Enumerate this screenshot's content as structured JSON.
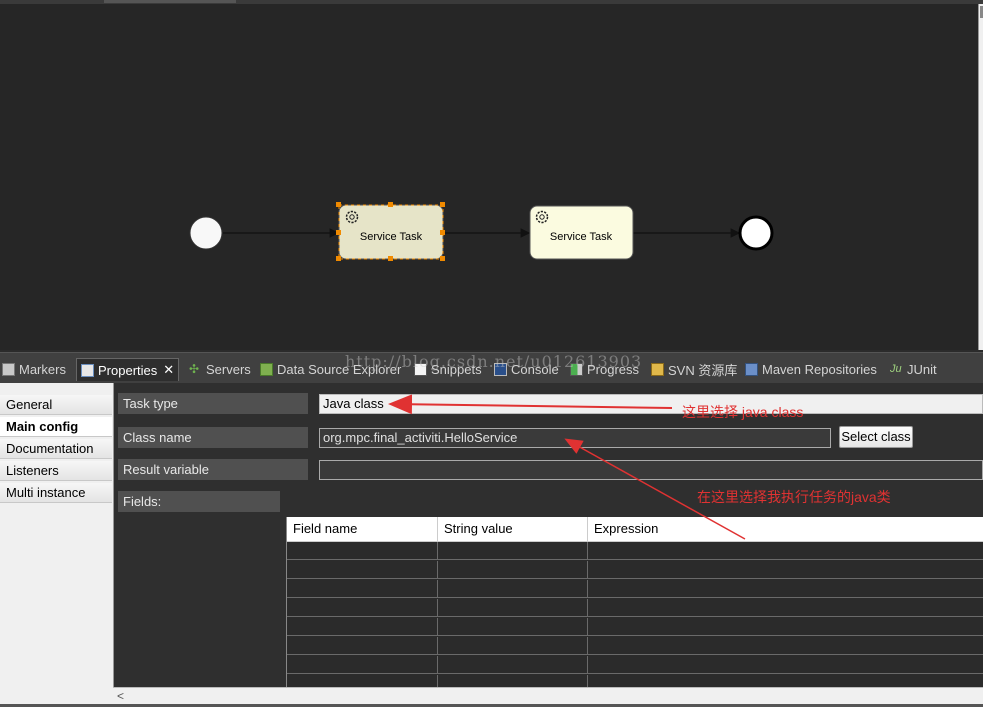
{
  "diagram": {
    "task1_label": "Service Task",
    "task2_label": "Service Task"
  },
  "view_tabs": [
    {
      "label": "Markers",
      "icon": "markers-icon"
    },
    {
      "label": "Properties",
      "icon": "properties-icon",
      "active": true
    },
    {
      "label": "Servers",
      "icon": "servers-icon"
    },
    {
      "label": "Data Source Explorer",
      "icon": "data-source-explorer-icon"
    },
    {
      "label": "Snippets",
      "icon": "snippets-icon"
    },
    {
      "label": "Console",
      "icon": "console-icon"
    },
    {
      "label": "Progress",
      "icon": "progress-icon"
    },
    {
      "label": "SVN 资源库",
      "icon": "svn-repository-icon"
    },
    {
      "label": "Maven Repositories",
      "icon": "maven-repositories-icon"
    },
    {
      "label": "JUnit",
      "icon": "junit-icon"
    }
  ],
  "watermark": "http://blog.csdn.net/u012613903",
  "properties_nav": [
    {
      "label": "General"
    },
    {
      "label": "Main config",
      "selected": true
    },
    {
      "label": "Documentation"
    },
    {
      "label": "Listeners"
    },
    {
      "label": "Multi instance"
    }
  ],
  "form": {
    "task_type_label": "Task type",
    "task_type_value": "Java class",
    "class_name_label": "Class name",
    "class_name_value": "org.mpc.final_activiti.HelloService",
    "select_class_button": "Select class",
    "result_variable_label": "Result variable",
    "result_variable_value": "",
    "fields_label": "Fields:"
  },
  "fields_table": {
    "columns": [
      "Field name",
      "String value",
      "Expression"
    ],
    "rows": 8
  },
  "annotations": {
    "note1": "这里选择 java class",
    "note2": "在这里选择我执行任务的java类",
    "color": "#e03232"
  },
  "colors": {
    "canvas_bg": "#262626",
    "task_selected_fill": "#e6e4c8",
    "task_fill": "#fbfbe0",
    "selection_handle": "#f08a00"
  }
}
